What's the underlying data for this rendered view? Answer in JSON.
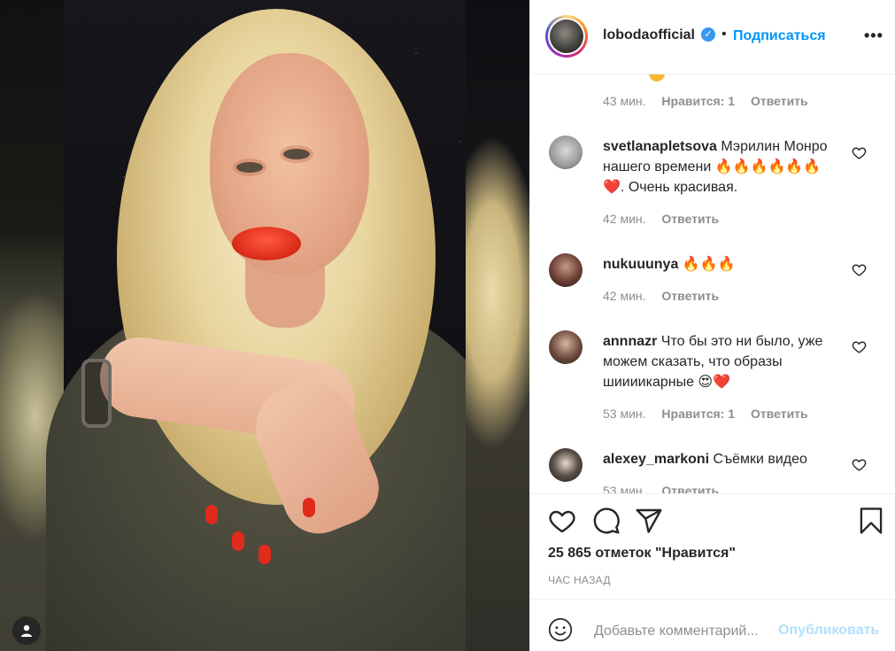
{
  "header": {
    "username": "lobodaofficial",
    "verified_icon": "verified-badge-icon",
    "separator": "•",
    "follow_label": "Подписаться",
    "more_label": "•••"
  },
  "comments": [
    {
      "username": "",
      "text": "",
      "time": "43 мин.",
      "likes": "Нравится: 1",
      "reply": "Ответить"
    },
    {
      "username": "svetlanapletsova",
      "text": "Мэрилин Монро нашего времени 🔥🔥🔥🔥🔥🔥❤️. Очень красивая.",
      "time": "42 мин.",
      "likes": "",
      "reply": "Ответить"
    },
    {
      "username": "nukuuunya",
      "text": "🔥🔥🔥",
      "time": "42 мин.",
      "likes": "",
      "reply": "Ответить"
    },
    {
      "username": "annnazr",
      "text": "Что бы это ни было, уже можем сказать, что образы шиииикарные 😍❤️",
      "time": "53 мин.",
      "likes": "Нравится: 1",
      "reply": "Ответить"
    },
    {
      "username": "alexey_markoni",
      "text": "Съёмки видео",
      "time": "53 мин.",
      "likes": "",
      "reply": "Ответить"
    }
  ],
  "actions": {
    "likes_text": "25 865 отметок \"Нравится\"",
    "time_ago": "ЧАС НАЗАД"
  },
  "add_comment": {
    "placeholder": "Добавьте комментарий...",
    "post_label": "Опубликовать"
  },
  "colors": {
    "link_blue": "#0095f6",
    "post_disabled": "#b2dffc",
    "meta_gray": "#8e8e8e",
    "verified": "#3897f0"
  }
}
